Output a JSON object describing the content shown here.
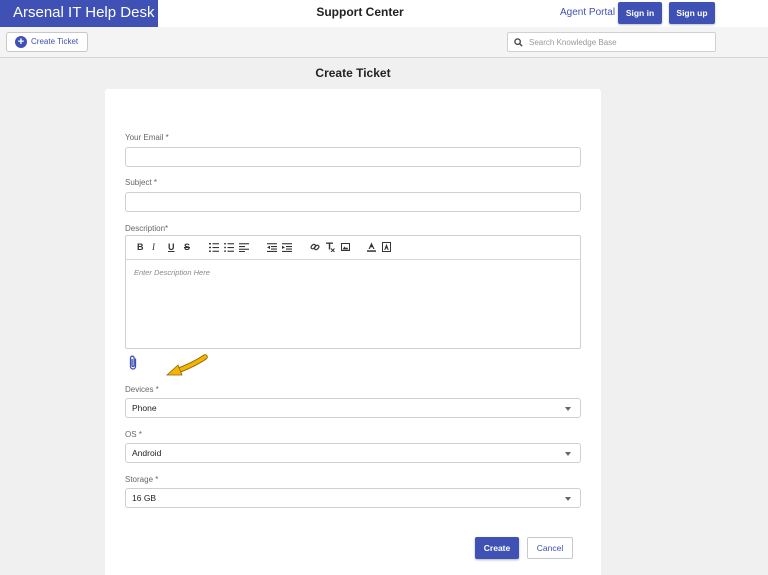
{
  "header": {
    "brand": "Arsenal IT Help Desk",
    "title": "Support Center",
    "agent_portal": "Agent Portal",
    "sign_in": "Sign in",
    "sign_up": "Sign up"
  },
  "toolbar": {
    "create_ticket": "Create Ticket",
    "search_placeholder": "Search Knowledge Base"
  },
  "form": {
    "heading": "Create Ticket",
    "email_label": "Your Email *",
    "subject_label": "Subject *",
    "description_label": "Description*",
    "description_placeholder": "Enter Description Here",
    "devices_label": "Devices *",
    "devices_value": "Phone",
    "os_label": "OS *",
    "os_value": "Android",
    "storage_label": "Storage *",
    "storage_value": "16 GB",
    "create_button": "Create",
    "cancel_button": "Cancel"
  },
  "editor_toolbar": {
    "bold": "B",
    "italic": "I",
    "underline": "U",
    "strike": "S"
  },
  "colors": {
    "primary": "#3f51b5",
    "arrow": "#f5b400"
  },
  "icons": [
    "plus-circle-icon",
    "search-icon",
    "bold-icon",
    "italic-icon",
    "underline-icon",
    "strikethrough-icon",
    "ordered-list-icon",
    "bullet-list-icon",
    "align-left-icon",
    "outdent-icon",
    "indent-icon",
    "link-icon",
    "clear-format-icon",
    "image-icon",
    "font-color-icon",
    "background-color-icon",
    "paperclip-icon",
    "arrow-icon",
    "chevron-down-icon"
  ]
}
